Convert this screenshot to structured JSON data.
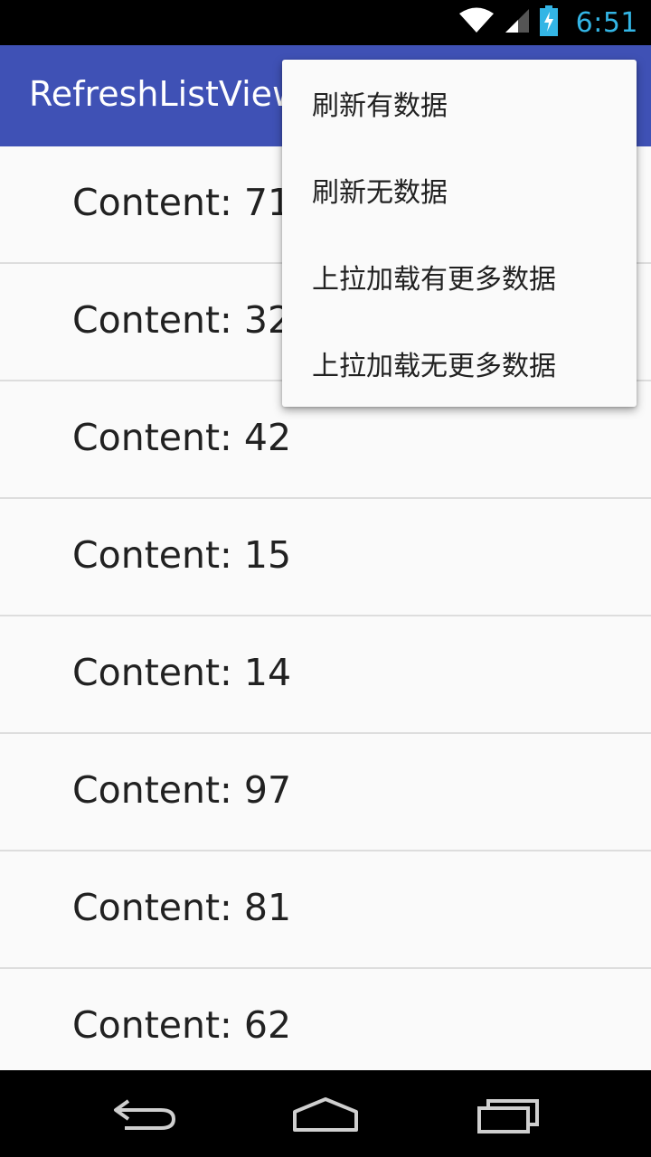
{
  "status_bar": {
    "time": "6:51",
    "icons": [
      "wifi-icon",
      "cell-signal-icon",
      "battery-charging-icon"
    ],
    "accent_color": "#33b5e5"
  },
  "app_bar": {
    "title": "RefreshListView",
    "color": "#3f51b5"
  },
  "list": {
    "items": [
      {
        "label": "Content: 71"
      },
      {
        "label": "Content: 32"
      },
      {
        "label": "Content: 42"
      },
      {
        "label": "Content: 15"
      },
      {
        "label": "Content: 14"
      },
      {
        "label": "Content: 97"
      },
      {
        "label": "Content: 81"
      },
      {
        "label": "Content: 62"
      }
    ]
  },
  "overflow_menu": {
    "items": [
      {
        "label": "刷新有数据"
      },
      {
        "label": "刷新无数据"
      },
      {
        "label": "上拉加载有更多数据"
      },
      {
        "label": "上拉加载无更多数据"
      }
    ]
  },
  "nav_bar": {
    "buttons": [
      "back-icon",
      "home-icon",
      "recent-apps-icon"
    ]
  }
}
